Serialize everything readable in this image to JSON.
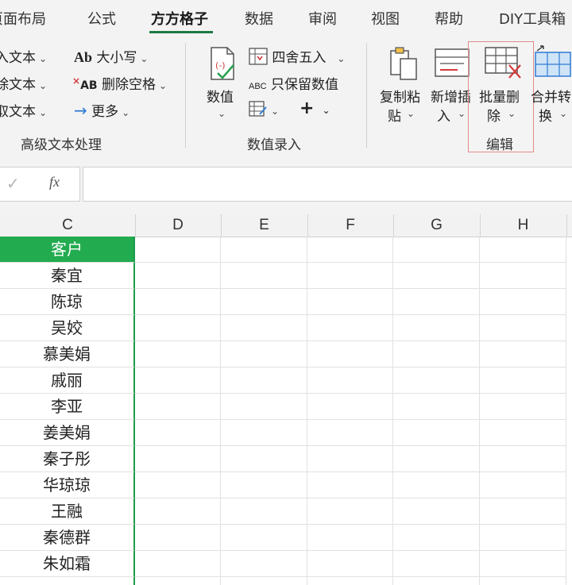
{
  "tabs": [
    {
      "label": "页面布局",
      "active": false
    },
    {
      "label": "公式",
      "active": false
    },
    {
      "label": "方方格子",
      "active": true
    },
    {
      "label": "数据",
      "active": false
    },
    {
      "label": "审阅",
      "active": false
    },
    {
      "label": "视图",
      "active": false
    },
    {
      "label": "帮助",
      "active": false
    },
    {
      "label": "DIY工具箱",
      "active": false
    }
  ],
  "ribbon": {
    "group_text": {
      "title": "高级文本处理",
      "items": [
        "入文本",
        "除文本",
        "取文本"
      ],
      "case_label": "大小写",
      "remove_spaces_label": "删除空格",
      "more_label": "更多",
      "ab_icon_text": "Ab",
      "xab_icon_text": "AB"
    },
    "group_values": {
      "title": "数值录入",
      "values_label": "数值",
      "round_label": "四舍五入",
      "keep_values_label": "只保留数值",
      "abc_icon_text": "ABC"
    },
    "group_edit": {
      "title": "编辑",
      "copy_paste_label": [
        "复制粘",
        "贴"
      ],
      "insert_label": [
        "新增插",
        "入"
      ],
      "batch_delete_label": [
        "批量删",
        "除"
      ],
      "merge_label": [
        "合并转",
        "换"
      ]
    }
  },
  "formula_bar": {
    "cancel_icon": "check-icon",
    "fx_label": "fx",
    "value": ""
  },
  "columns": [
    "C",
    "D",
    "E",
    "F",
    "G",
    "H"
  ],
  "header_cell": "客户",
  "customers": [
    "秦宜",
    "陈琼",
    "吴姣",
    "慕美娟",
    "戚丽",
    "李亚",
    "姜美娟",
    "秦子彤",
    "华琼琼",
    "王融",
    "秦德群",
    "朱如霜"
  ],
  "colors": {
    "accent_green": "#22ab4f",
    "active_tab_underline": "#1e7a45",
    "highlight_border": "#e48a8a"
  }
}
